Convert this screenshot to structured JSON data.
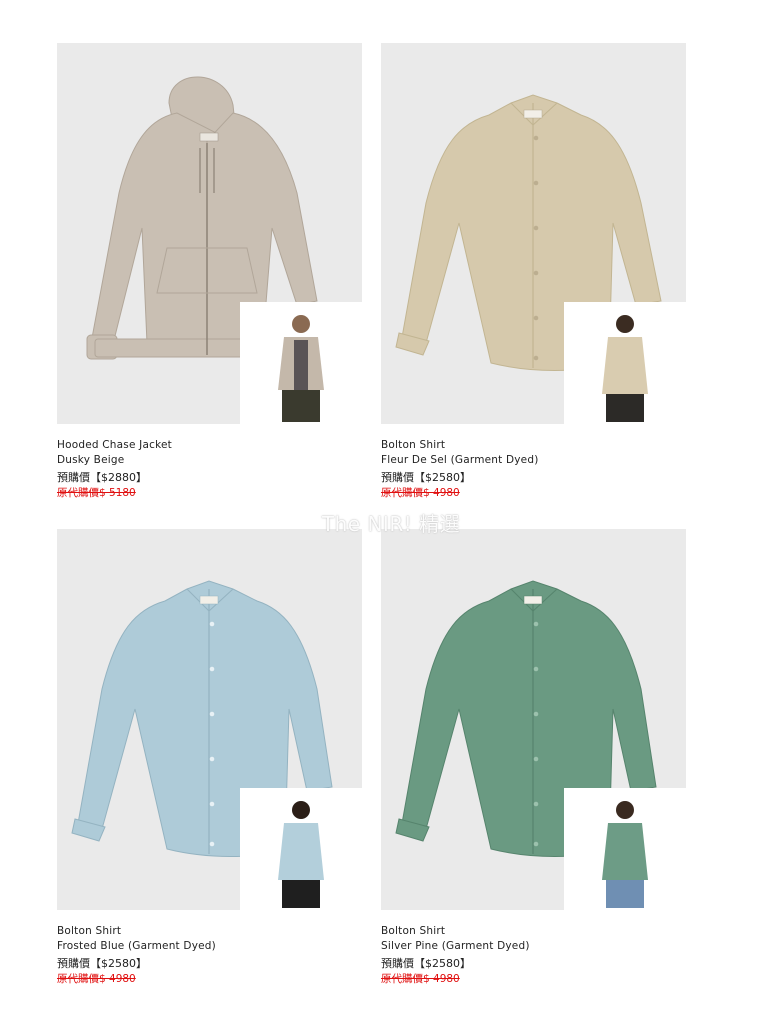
{
  "watermark": "The NIR! 精選",
  "products": [
    {
      "name": "Hooded Chase Jacket",
      "color": "Dusky Beige",
      "preorder_price": "預購價【$2880】",
      "original_price": "原代購價$ 5180",
      "garment_color": "#c9bfb3",
      "model_top_color": "#c4b8aa",
      "model_bottom_color": "#3a3a2e"
    },
    {
      "name": "Bolton Shirt",
      "color": "Fleur De Sel (Garment Dyed)",
      "preorder_price": "預購價【$2580】",
      "original_price": "原代購價$ 4980",
      "garment_color": "#d6c9ac",
      "model_top_color": "#d9ccb0",
      "model_bottom_color": "#2c2a27"
    },
    {
      "name": "Bolton Shirt",
      "color": "Frosted Blue (Garment Dyed)",
      "preorder_price": "預購價【$2580】",
      "original_price": "原代購價$ 4980",
      "garment_color": "#aecbd8",
      "model_top_color": "#b3cfdb",
      "model_bottom_color": "#1f1f1f"
    },
    {
      "name": "Bolton Shirt",
      "color": "Silver Pine (Garment Dyed)",
      "preorder_price": "預購價【$2580】",
      "original_price": "原代購價$ 4980",
      "garment_color": "#6a9a82",
      "model_top_color": "#6d9c86",
      "model_bottom_color": "#6f8fb3"
    }
  ]
}
